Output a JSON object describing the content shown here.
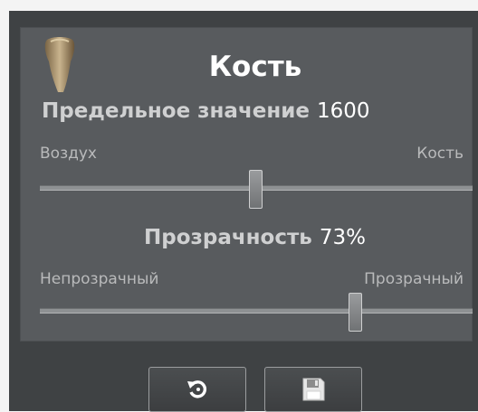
{
  "panel": {
    "title": "Кость",
    "icon": "tooth-icon"
  },
  "threshold": {
    "label": "Предельное значение",
    "value": "1600",
    "min_label": "Воздух",
    "max_label": "Кость",
    "position": 0.5
  },
  "opacity": {
    "label": "Прозрачность",
    "value": "73%",
    "min_label": "Непрозрачный",
    "max_label": "Прозрачный",
    "position": 0.73
  },
  "buttons": [
    {
      "icon": "reset-icon"
    },
    {
      "icon": "save-icon"
    }
  ],
  "colors": {
    "background": "#3f4244",
    "panel": "#585b5e",
    "text": "#ffffff",
    "muted_text": "#b9babb"
  }
}
